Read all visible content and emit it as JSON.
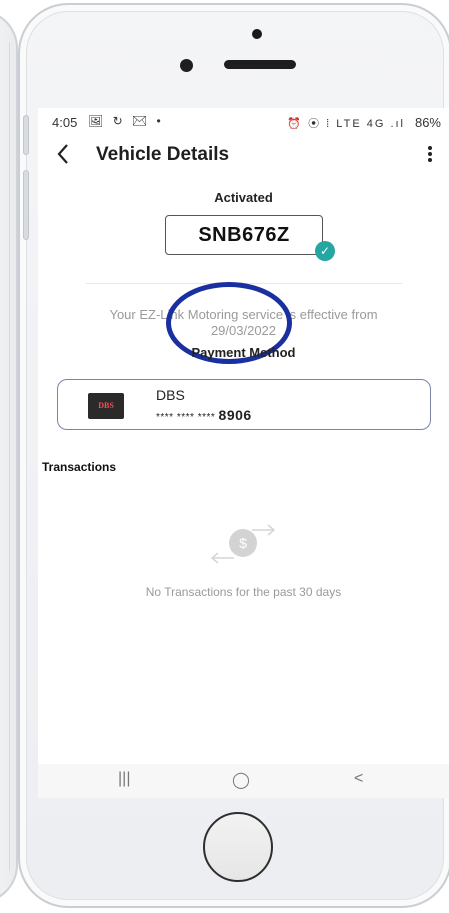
{
  "status_bar": {
    "time": "4:05",
    "left_icons": "🖼 ↻ ✉ •",
    "right_icons": "⏰ ⦿ ⁞ LTE 4G .ıl",
    "battery": "86%"
  },
  "header": {
    "back_icon": "chevron-left",
    "title": "Vehicle Details",
    "menu_icon": "kebab-menu"
  },
  "vehicle": {
    "status": "Activated",
    "plate": "SNB676Z",
    "verified_icon": "check-circle"
  },
  "service": {
    "text": "Your EZ-Link Motoring service is effective from",
    "date": "29/03/2022"
  },
  "payment": {
    "heading": "Payment Method",
    "bank_logo_text": "DBS",
    "bank_name": "DBS",
    "card_mask": "**** **** ****",
    "card_last4": "8906"
  },
  "transactions": {
    "heading": "Transactions",
    "empty_icon": "money-transfer",
    "empty_text": "No Transactions for the past 30 days"
  },
  "nav": {
    "recent_icon": "|||",
    "home_icon": "◯",
    "back_icon": "<"
  },
  "colors": {
    "annotation_ring": "#1a2fa0",
    "check_badge": "#26a6a0",
    "card_border": "#7c83a8"
  }
}
